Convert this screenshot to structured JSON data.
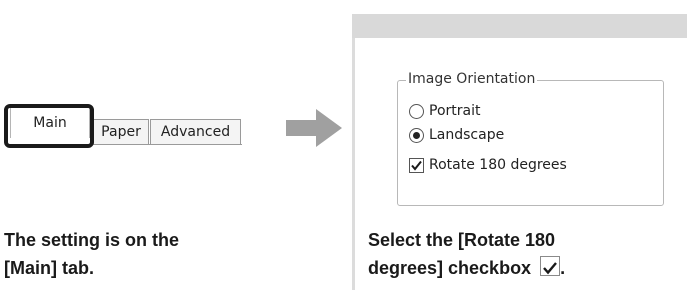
{
  "tabs": [
    {
      "label": "Main",
      "active": true
    },
    {
      "label": "Paper",
      "active": false
    },
    {
      "label": "Advanced",
      "active": false
    }
  ],
  "left_caption": {
    "line1": "The setting is on the",
    "line2": "[Main] tab."
  },
  "dialog": {
    "group_label": "Image Orientation",
    "orientation_options": [
      {
        "label": "Portrait",
        "selected": false
      },
      {
        "label": "Landscape",
        "selected": true
      }
    ],
    "rotate_checkbox": {
      "label": "Rotate 180 degrees",
      "checked": true
    }
  },
  "right_caption": {
    "line1": "Select the [Rotate 180",
    "line2": "degrees] checkbox",
    "line2_suffix": "."
  },
  "icons": {
    "arrow": "right-arrow-icon",
    "checkbox": "checkmark-icon"
  },
  "colors": {
    "arrow": "#a0a0a0",
    "highlight_border": "#1a1a1a",
    "panel_header": "#d9d9d9"
  }
}
